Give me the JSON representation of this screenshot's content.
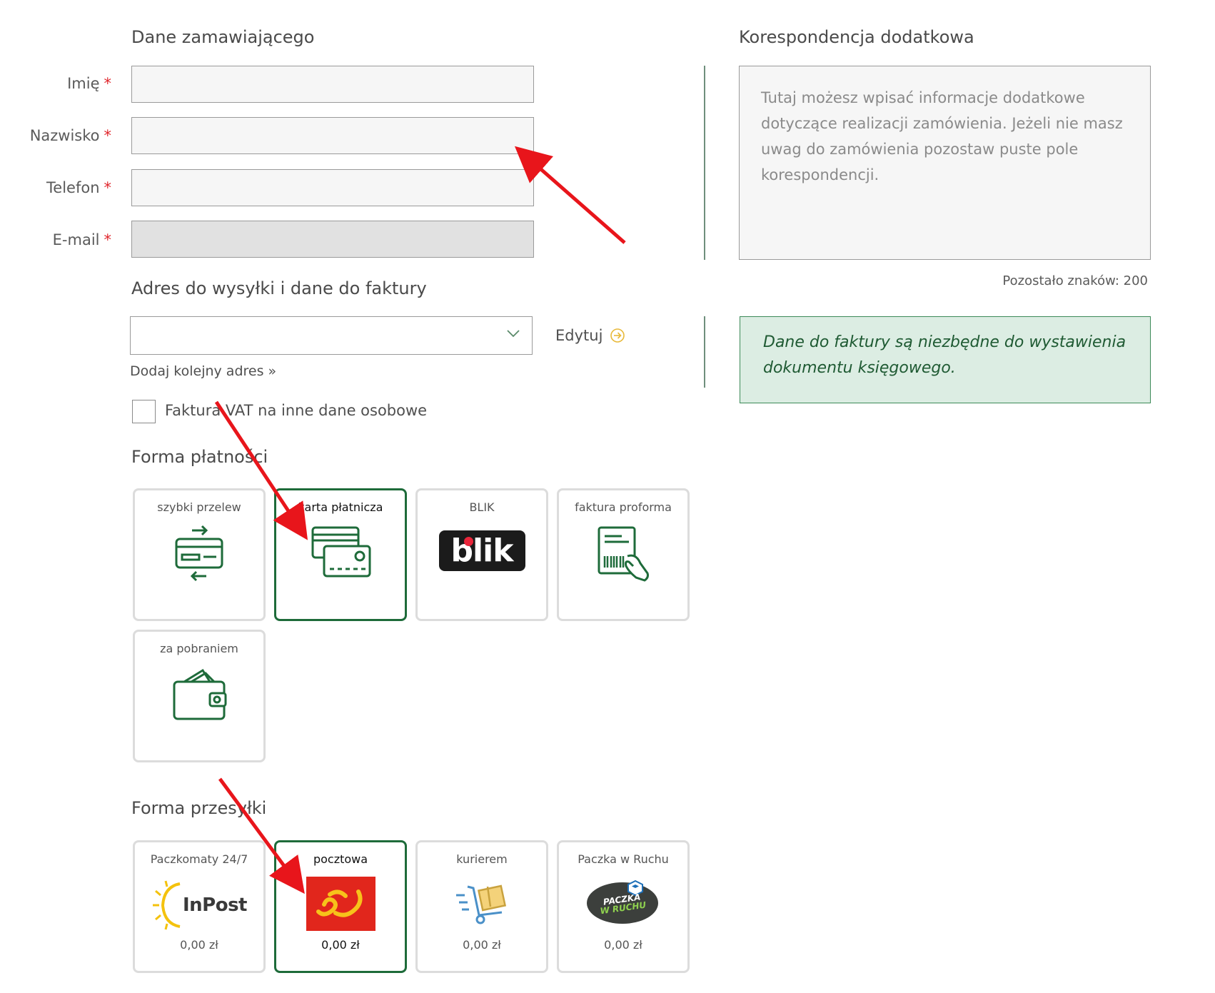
{
  "orderer": {
    "title": "Dane zamawiającego",
    "required_mark": "*",
    "fields": [
      {
        "label": "Imię",
        "value": ""
      },
      {
        "label": "Nazwisko",
        "value": ""
      },
      {
        "label": "Telefon",
        "value": ""
      },
      {
        "label": "E-mail",
        "value": ""
      }
    ]
  },
  "correspondence": {
    "title": "Korespondencja dodatkowa",
    "placeholder": "Tutaj możesz wpisać informacje dodatkowe dotyczące realizacji zamówienia. Jeżeli nie masz uwag do zamówienia pozostaw puste pole korespondencji.",
    "counter": "Pozostało znaków: 200"
  },
  "address": {
    "title": "Adres do wysyłki i dane do faktury",
    "selected": "",
    "edit_label": "Edytuj",
    "add_link": "Dodaj kolejny adres »",
    "vat_checkbox_label": "Faktura VAT na inne dane osobowe",
    "vat_checked": false
  },
  "invoice_note": "Dane do faktury są niezbędne do wystawienia dokumentu księgowego.",
  "payment": {
    "title": "Forma płatności",
    "options": [
      {
        "label": "szybki przelew",
        "icon": "transfer-icon",
        "selected": false
      },
      {
        "label": "karta płatnicza",
        "icon": "card-icon",
        "selected": true
      },
      {
        "label": "BLIK",
        "icon": "blik-logo",
        "logo_text": "blik",
        "selected": false
      },
      {
        "label": "faktura proforma",
        "icon": "invoice-icon",
        "selected": false
      },
      {
        "label": "za pobraniem",
        "icon": "wallet-icon",
        "selected": false
      }
    ]
  },
  "shipping": {
    "title": "Forma przesyłki",
    "options": [
      {
        "label": "Paczkomaty 24/7",
        "icon": "inpost-logo",
        "logo_text": "InPost",
        "price": "0,00 zł",
        "selected": false
      },
      {
        "label": "pocztowa",
        "icon": "poczta-logo",
        "price": "0,00 zł",
        "selected": true
      },
      {
        "label": "kurierem",
        "icon": "courier-icon",
        "price": "0,00 zł",
        "selected": false
      },
      {
        "label": "Paczka w Ruchu",
        "icon": "ruch-logo",
        "logo_text": [
          "PACZKA",
          "W RUCHU"
        ],
        "price": "0,00 zł",
        "selected": false
      }
    ]
  },
  "colors": {
    "brand_green": "#1e6b3a",
    "required_red": "#e0262c",
    "annotation_arrow": "#e8151b",
    "info_bg": "#dcede3"
  }
}
